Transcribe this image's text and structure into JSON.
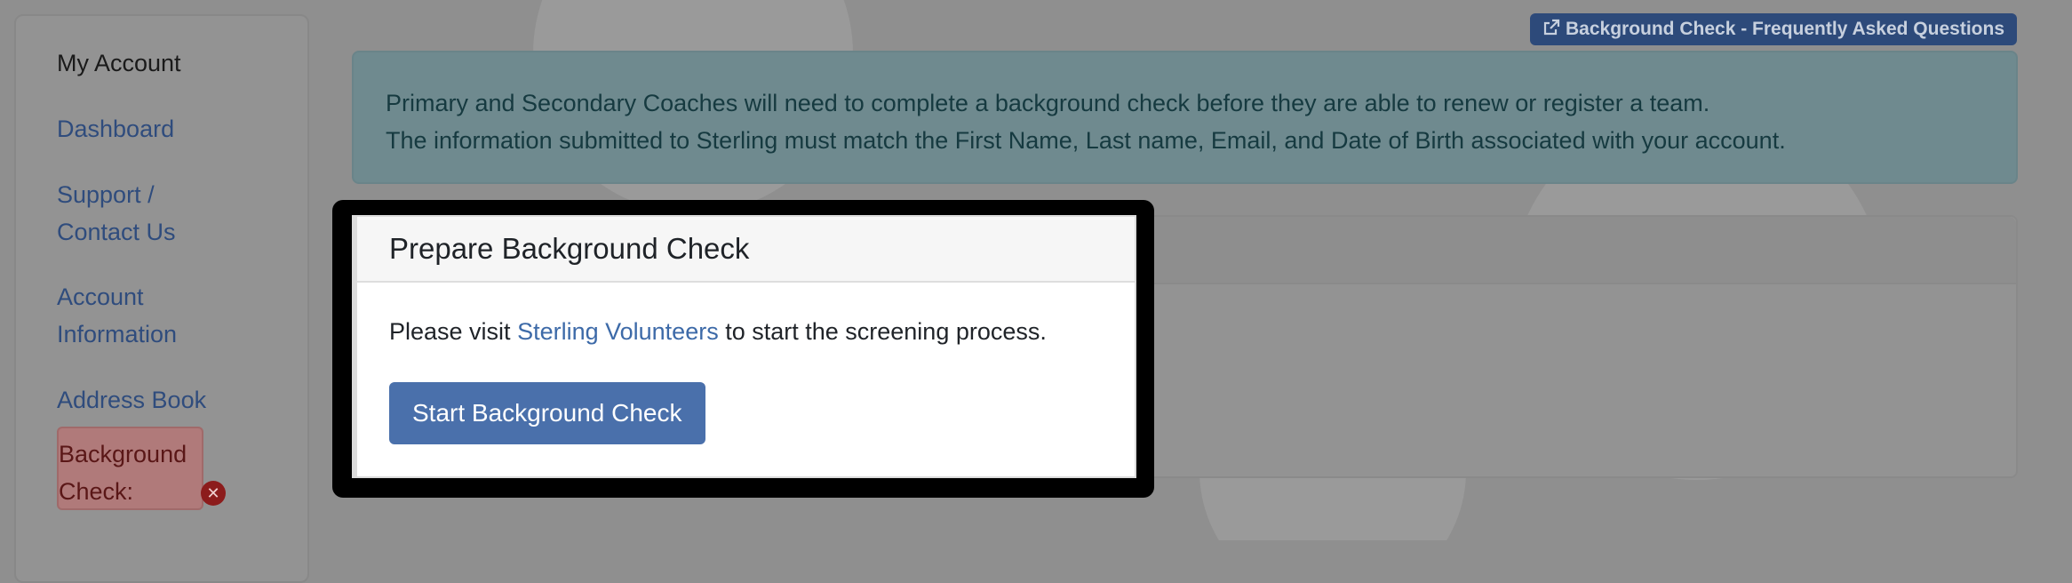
{
  "sidebar": {
    "items": [
      {
        "label": "My Account"
      },
      {
        "label": "Dashboard"
      },
      {
        "label": "Support / Contact Us"
      },
      {
        "label": "Account Information"
      },
      {
        "label": "Address Book"
      },
      {
        "label": "Background Check:"
      }
    ],
    "status_icon": "close-circle-icon"
  },
  "faq_link": {
    "label": "Background Check - Frequently Asked Questions",
    "icon": "external-link-icon"
  },
  "alert": {
    "line1": "Primary and Secondary Coaches will need to complete a background check before they are able to renew or register a team.",
    "line2": "The information submitted to Sterling must match the First Name, Last name, Email, and Date of Birth associated with your account."
  },
  "modal": {
    "title": "Prepare Background Check",
    "text_before": "Please visit ",
    "link_label": "Sterling Volunteers",
    "text_after": " to start the screening process.",
    "button_label": "Start Background Check"
  },
  "colors": {
    "link": "#3d6aa8",
    "button": "#4a70ab",
    "badge": "#2d4a7a",
    "danger": "#8c1c1c"
  }
}
